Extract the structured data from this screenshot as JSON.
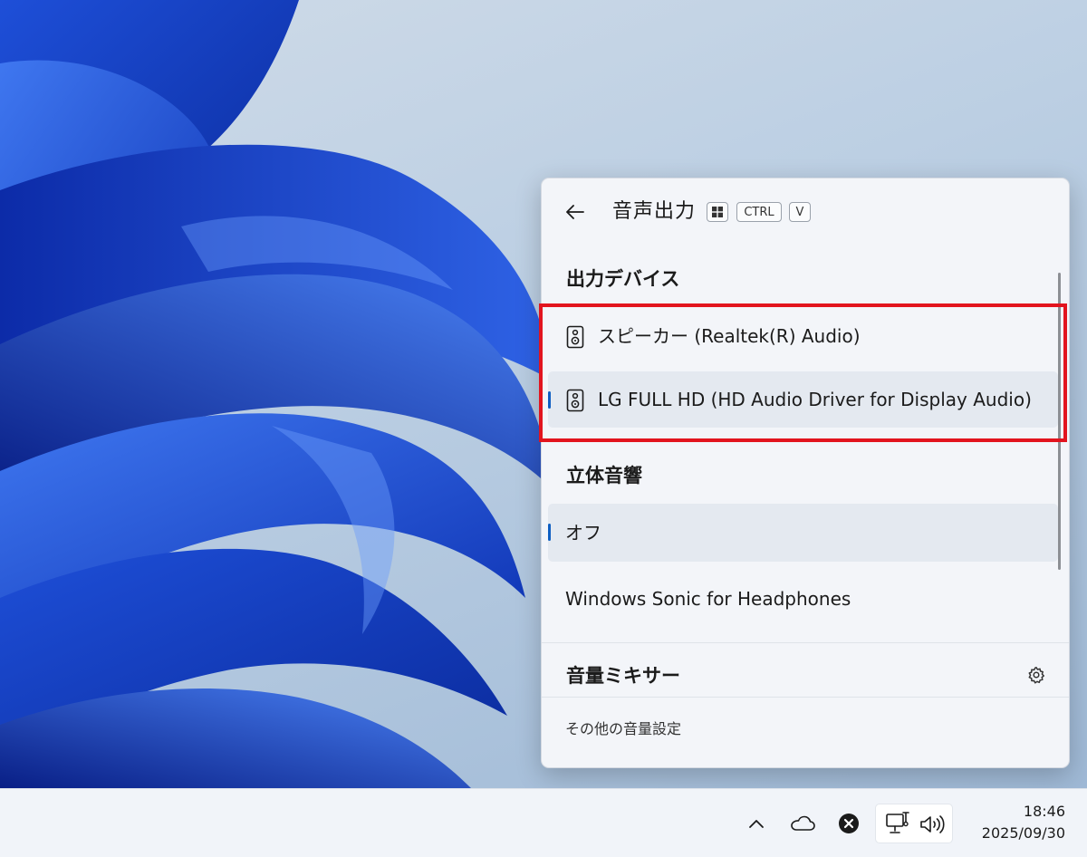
{
  "audio_flyout": {
    "title": "音声出力",
    "shortcut_keys": {
      "win_icon": "windows-logo-icon",
      "ctrl": "CTRL",
      "v": "V"
    },
    "output_devices": {
      "heading": "出力デバイス",
      "items": [
        {
          "label": "スピーカー (Realtek(R) Audio)",
          "icon": "speaker-icon",
          "selected": false
        },
        {
          "label": "LG FULL HD (HD Audio Driver for Display Audio)",
          "icon": "speaker-icon",
          "selected": true
        }
      ]
    },
    "spatial_sound": {
      "heading": "立体音響",
      "items": [
        {
          "label": "オフ",
          "selected": true
        },
        {
          "label": "Windows Sonic for Headphones",
          "selected": false
        }
      ]
    },
    "volume_mixer": {
      "heading": "音量ミキサー",
      "settings_icon": "gear-icon"
    },
    "more_settings_link": "その他の音量設定"
  },
  "taskbar": {
    "tray_icons": [
      "chevron-up-icon",
      "cloud-icon",
      "close-circle-icon",
      "network-icon",
      "volume-icon"
    ],
    "clock": {
      "time": "18:46",
      "date": "2025/09/30"
    }
  },
  "colors": {
    "accent": "#0f5fc2",
    "highlight": "#e2141e",
    "panel_background": "#f3f5f9",
    "selected_row": "#e4e9f0"
  }
}
